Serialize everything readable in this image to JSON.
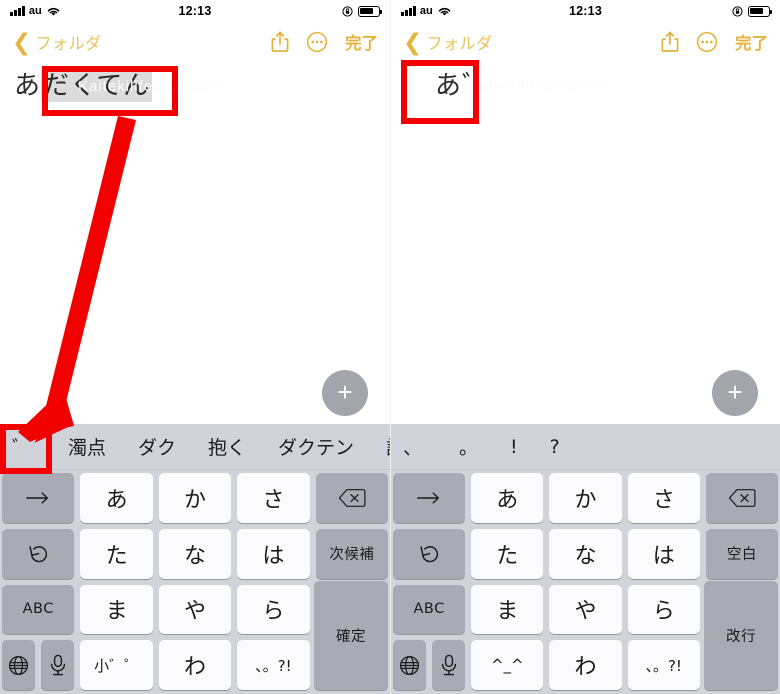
{
  "theme": {
    "accent": "#e3b33c",
    "annotation": "#f20000",
    "keyboard_bg": "#d0d3da",
    "key_white": "#fbfbfd",
    "key_gray": "#a8abb4",
    "composing_bg": "#dcdcdc"
  },
  "status_bar": {
    "carrier": "au",
    "time": "12:13",
    "signal_icon": "signal-bars-icon",
    "wifi_icon": "wifi-icon",
    "lock_icon": "rotation-lock-icon",
    "battery_icon": "battery-icon"
  },
  "nav_bar": {
    "back_label": "フォルダ",
    "back_icon": "chevron-left-icon",
    "share_icon": "share-icon",
    "more_icon": "more-ellipsis-icon",
    "done_label": "完了"
  },
  "panels": [
    {
      "id": "left",
      "note": {
        "committed_text": "あ",
        "composing_text": "だくてん",
        "watermark": "Kaitekilifeblog.com"
      },
      "fab": {
        "label": "+",
        "icon": "plus-icon"
      },
      "suggestions": {
        "items": [
          "゛",
          "濁点",
          "ダク",
          "抱く",
          "ダクテン"
        ],
        "clipped_item": "説",
        "expand_icon": "chevron-down-icon"
      },
      "keyboard": {
        "rows": [
          [
            {
              "label": "→",
              "icon": "arrow-right-icon",
              "style": "gray"
            },
            {
              "label": "あ",
              "style": "white"
            },
            {
              "label": "か",
              "style": "white"
            },
            {
              "label": "さ",
              "style": "white"
            },
            {
              "label": "⌫",
              "icon": "delete-icon",
              "style": "gray"
            }
          ],
          [
            {
              "label": "↺",
              "icon": "undo-icon",
              "style": "gray"
            },
            {
              "label": "た",
              "style": "white"
            },
            {
              "label": "な",
              "style": "white"
            },
            {
              "label": "は",
              "style": "white"
            },
            {
              "label": "次候補",
              "style": "gray"
            }
          ],
          [
            {
              "label": "ABC",
              "style": "gray"
            },
            {
              "label": "ま",
              "style": "white"
            },
            {
              "label": "や",
              "style": "white"
            },
            {
              "label": "ら",
              "style": "white"
            }
          ],
          [
            {
              "label": "🌐",
              "icon": "globe-icon",
              "style": "gray"
            },
            {
              "label": "🎤",
              "icon": "microphone-icon",
              "style": "gray"
            },
            {
              "label": "小゛゜",
              "style": "white"
            },
            {
              "label": "わ",
              "style": "white"
            },
            {
              "label": "、。?!",
              "style": "white"
            }
          ]
        ],
        "action_key": "確定"
      }
    },
    {
      "id": "right",
      "note": {
        "committed_text": "あ゛",
        "composing_text": "",
        "watermark": "Kaitekilifeblog.com"
      },
      "fab": {
        "label": "+",
        "icon": "plus-icon"
      },
      "suggestions": {
        "items": [
          "、",
          "。",
          "!",
          "?"
        ],
        "clipped_item": "",
        "expand_icon": ""
      },
      "keyboard": {
        "rows": [
          [
            {
              "label": "→",
              "icon": "arrow-right-icon",
              "style": "gray"
            },
            {
              "label": "あ",
              "style": "white"
            },
            {
              "label": "か",
              "style": "white"
            },
            {
              "label": "さ",
              "style": "white"
            },
            {
              "label": "⌫",
              "icon": "delete-icon",
              "style": "gray"
            }
          ],
          [
            {
              "label": "↺",
              "icon": "undo-icon",
              "style": "gray"
            },
            {
              "label": "た",
              "style": "white"
            },
            {
              "label": "な",
              "style": "white"
            },
            {
              "label": "は",
              "style": "white"
            },
            {
              "label": "空白",
              "style": "gray"
            }
          ],
          [
            {
              "label": "ABC",
              "style": "gray"
            },
            {
              "label": "ま",
              "style": "white"
            },
            {
              "label": "や",
              "style": "white"
            },
            {
              "label": "ら",
              "style": "white"
            }
          ],
          [
            {
              "label": "🌐",
              "icon": "globe-icon",
              "style": "gray"
            },
            {
              "label": "🎤",
              "icon": "microphone-icon",
              "style": "gray"
            },
            {
              "label": "^_^",
              "style": "white"
            },
            {
              "label": "わ",
              "style": "white"
            },
            {
              "label": "、。?!",
              "style": "white"
            }
          ]
        ],
        "action_key": "改行"
      }
    }
  ],
  "annotations": {
    "text_highlight_box": "composing-text-callout",
    "dakuten_key_box": "dakuten-suggestion-callout",
    "result_box": "result-text-callout",
    "arrow": "red-pointer-arrow"
  }
}
